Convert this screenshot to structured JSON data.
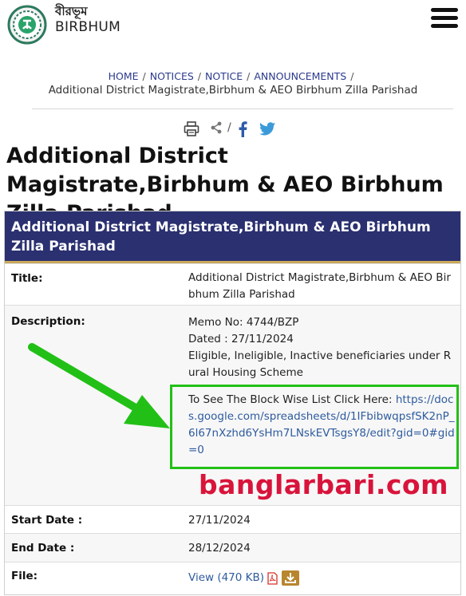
{
  "header": {
    "site_name_bn": "বীরভূম",
    "site_name_en": "BIRBHUM",
    "logo_icon": "west-bengal-emblem-icon",
    "menu_icon": "hamburger-menu-icon"
  },
  "breadcrumb": {
    "items": [
      "HOME",
      "NOTICES",
      "NOTICE",
      "ANNOUNCEMENTS"
    ],
    "separator": "/",
    "current": "Additional District Magistrate,Birbhum & AEO Birbhum Zilla Parishad"
  },
  "tools": {
    "print_icon": "print-icon",
    "share_icon": "share-icon",
    "separator": "/",
    "facebook_icon": "facebook-icon",
    "twitter_icon": "twitter-icon"
  },
  "page_title": "Additional District Magistrate,Birbhum & AEO Birbhum Zilla Parishad",
  "table": {
    "header": "Additional District Magistrate,Birbhum & AEO Birbhum Zilla Parishad",
    "title_label": "Title:",
    "title_value": "Additional District Magistrate,Birbhum & AEO Birbhum Zilla Parishad",
    "description_label": "Description:",
    "description_lines": [
      "Memo No: 4744/BZP",
      "Dated : 27/11/2024",
      "Eligible, Ineligible, Inactive beneficiaries under Rural Housing Scheme"
    ],
    "block_list_text": "To See The Block Wise List Click Here: ",
    "block_list_link": "https://docs.google.com/spreadsheets/d/1IFbibwqpsfSK2nP_6l67nXzhd6YsHm7LNskEVTsgsY8/edit?gid=0#gid=0",
    "start_date_label": "Start Date :",
    "start_date": "27/11/2024",
    "end_date_label": "End Date :",
    "end_date": "28/12/2024",
    "file_label": "File:",
    "file_link": "View (470 KB)",
    "pdf_icon": "pdf-icon",
    "download_icon": "download-icon"
  },
  "watermark": "banglarbari.com",
  "colors": {
    "header_bg": "#2a3070",
    "header_border": "#c9a95a",
    "breadcrumb_link": "#2b3a8c",
    "link": "#2e5b9e",
    "highlight_box": "#22c017",
    "watermark": "#d8143b"
  }
}
